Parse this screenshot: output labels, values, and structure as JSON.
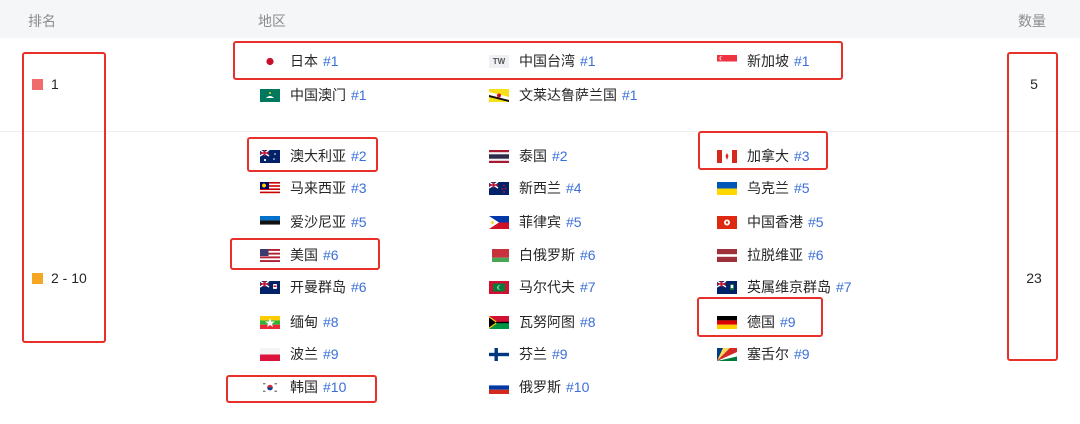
{
  "header": {
    "rank": "排名",
    "region": "地区",
    "count": "数量"
  },
  "groups": [
    {
      "label": "1",
      "color": "#f06b6b",
      "count": "5"
    },
    {
      "label": "2 - 10",
      "color": "#f5a623",
      "count": "23"
    }
  ],
  "entries": [
    {
      "name": "日本",
      "rank": "#1",
      "flag": "japan"
    },
    {
      "name": "中国台湾",
      "rank": "#1",
      "flag": "tw-text"
    },
    {
      "name": "新加坡",
      "rank": "#1",
      "flag": "singapore"
    },
    {
      "name": "中国澳门",
      "rank": "#1",
      "flag": "macau"
    },
    {
      "name": "文莱达鲁萨兰国",
      "rank": "#1",
      "flag": "brunei"
    },
    {
      "name": "澳大利亚",
      "rank": "#2",
      "flag": "australia"
    },
    {
      "name": "泰国",
      "rank": "#2",
      "flag": "thailand"
    },
    {
      "name": "加拿大",
      "rank": "#3",
      "flag": "canada"
    },
    {
      "name": "马来西亚",
      "rank": "#3",
      "flag": "malaysia"
    },
    {
      "name": "新西兰",
      "rank": "#4",
      "flag": "new-zealand"
    },
    {
      "name": "乌克兰",
      "rank": "#5",
      "flag": "ukraine"
    },
    {
      "name": "爱沙尼亚",
      "rank": "#5",
      "flag": "estonia"
    },
    {
      "name": "菲律宾",
      "rank": "#5",
      "flag": "philippines"
    },
    {
      "name": "中国香港",
      "rank": "#5",
      "flag": "hong-kong"
    },
    {
      "name": "美国",
      "rank": "#6",
      "flag": "usa"
    },
    {
      "name": "白俄罗斯",
      "rank": "#6",
      "flag": "belarus"
    },
    {
      "name": "拉脱维亚",
      "rank": "#6",
      "flag": "latvia"
    },
    {
      "name": "开曼群岛",
      "rank": "#6",
      "flag": "cayman"
    },
    {
      "name": "马尔代夫",
      "rank": "#7",
      "flag": "maldives"
    },
    {
      "name": "英属维京群岛",
      "rank": "#7",
      "flag": "bvi"
    },
    {
      "name": "缅甸",
      "rank": "#8",
      "flag": "myanmar"
    },
    {
      "name": "瓦努阿图",
      "rank": "#8",
      "flag": "vanuatu"
    },
    {
      "name": "德国",
      "rank": "#9",
      "flag": "germany"
    },
    {
      "name": "波兰",
      "rank": "#9",
      "flag": "poland"
    },
    {
      "name": "芬兰",
      "rank": "#9",
      "flag": "finland"
    },
    {
      "name": "塞舌尔",
      "rank": "#9",
      "flag": "seychelles"
    },
    {
      "name": "韩国",
      "rank": "#10",
      "flag": "korea"
    },
    {
      "name": "俄罗斯",
      "rank": "#10",
      "flag": "russia"
    }
  ],
  "tw_flag_text": "TW",
  "colors": {
    "link": "#3b6fd8",
    "highlight": "#e8302a",
    "header_bg": "#f5f6f8"
  }
}
